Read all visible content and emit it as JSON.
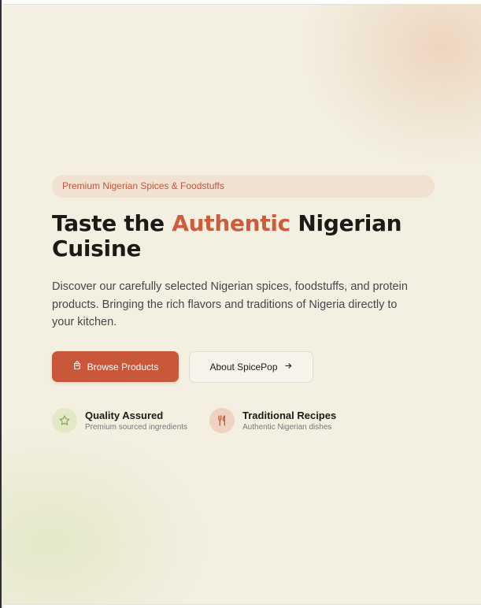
{
  "hero": {
    "badge": "Premium Nigerian Spices & Foodstuffs",
    "title_pre": "Taste the ",
    "title_accent": "Authentic",
    "title_post": " Nigerian Cuisine",
    "description": "Discover our carefully selected Nigerian spices, foodstuffs, and protein products. Bringing the rich flavors and traditions of Nigeria directly to your kitchen."
  },
  "actions": {
    "primary_label": "Browse Products",
    "primary_icon": "shopping-bag-icon",
    "secondary_label": "About SpicePop",
    "secondary_icon": "arrow-right-icon"
  },
  "features": [
    {
      "title": "Quality Assured",
      "subtitle": "Premium sourced ingredients",
      "icon": "star-icon"
    },
    {
      "title": "Traditional Recipes",
      "subtitle": "Authentic Nigerian dishes",
      "icon": "utensils-icon"
    }
  ],
  "colors": {
    "accent": "#cc5c3c",
    "primary_button": "#c9583a",
    "background": "#f3f0e2",
    "badge_bg": "#f0e1d1",
    "feature_green": "#e3e8c6",
    "feature_peach": "#f0d2c0"
  }
}
